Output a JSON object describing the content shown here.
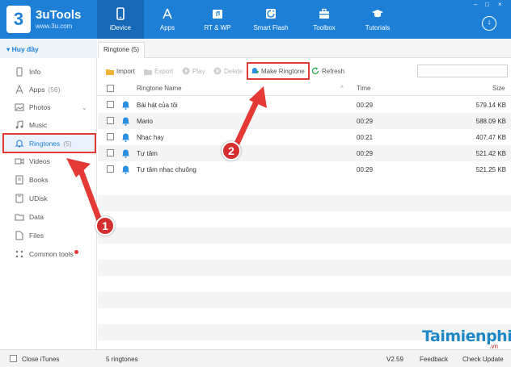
{
  "app": {
    "name": "3uTools",
    "url": "www.3u.com",
    "logo_glyph": "3"
  },
  "nav": [
    {
      "label": "iDevice",
      "icon": "phone-icon",
      "active": true
    },
    {
      "label": "Apps",
      "icon": "app-store-icon"
    },
    {
      "label": "RT & WP",
      "icon": "ringtone-wallpaper-icon"
    },
    {
      "label": "Smart Flash",
      "icon": "flash-icon"
    },
    {
      "label": "Toolbox",
      "icon": "toolbox-icon"
    },
    {
      "label": "Tutorials",
      "icon": "graduation-cap-icon"
    }
  ],
  "download_icon": "↓",
  "sidebar": {
    "device_name": "Huy đầy",
    "items": [
      {
        "label": "Info",
        "count": "",
        "icon": "phone-outline-icon"
      },
      {
        "label": "Apps",
        "count": "(56)",
        "icon": "apps-icon"
      },
      {
        "label": "Photos",
        "count": "",
        "icon": "photos-icon"
      },
      {
        "label": "Music",
        "count": "",
        "icon": "music-icon"
      },
      {
        "label": "Ringtones",
        "count": "(5)",
        "icon": "bell-icon",
        "active": true
      },
      {
        "label": "Videos",
        "count": "",
        "icon": "video-icon"
      },
      {
        "label": "Books",
        "count": "",
        "icon": "book-icon"
      },
      {
        "label": "UDisk",
        "count": "",
        "icon": "disk-icon"
      },
      {
        "label": "Data",
        "count": "",
        "icon": "folder-icon"
      },
      {
        "label": "Files",
        "count": "",
        "icon": "file-icon"
      },
      {
        "label": "Common tools",
        "count": "",
        "icon": "tools-icon"
      }
    ]
  },
  "tab": {
    "label": "Ringtone (5)"
  },
  "toolbar": {
    "import": "Import",
    "export": "Export",
    "play": "Play",
    "delete": "Delete",
    "make_ringtone": "Make Ringtone",
    "refresh": "Refresh"
  },
  "table": {
    "columns": {
      "name": "Ringtone Name",
      "time": "Time",
      "size": "Size"
    },
    "rows": [
      {
        "name": "Bài hát của tôi",
        "time": "00:29",
        "size": "579.14 KB"
      },
      {
        "name": "Mario",
        "time": "00:29",
        "size": "588.09 KB"
      },
      {
        "name": "Nhạc hay",
        "time": "00:21",
        "size": "407.47 KB"
      },
      {
        "name": "Tự tâm",
        "time": "00:29",
        "size": "521.42 KB"
      },
      {
        "name": "Tự tâm nhạc chuông",
        "time": "00:29",
        "size": "521.25 KB"
      }
    ]
  },
  "status": {
    "close_itunes": "Close iTunes",
    "count": "5 ringtones",
    "version": "V2.59",
    "feedback": "Feedback",
    "check_update": "Check Update"
  },
  "annotations": {
    "badge1": "1",
    "badge2": "2"
  },
  "watermark": {
    "text": "Taimienphi",
    "sub": ".vn"
  },
  "colors": {
    "accent": "#1e7fd7",
    "highlight": "#e53935",
    "badge": "#d32f2f"
  }
}
